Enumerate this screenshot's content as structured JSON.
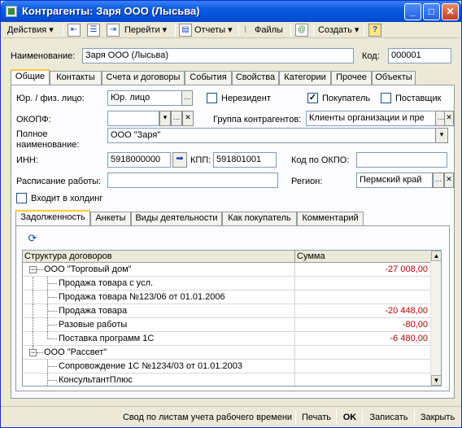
{
  "window": {
    "title": "Контрагенты: Заря ООО (Лысьва)"
  },
  "toolbar": {
    "actions": "Действия",
    "goto": "Перейти",
    "reports": "Отчеты",
    "files": "Файлы",
    "create": "Создать",
    "help": "?"
  },
  "header": {
    "name_label": "Наименование:",
    "name_value": "Заря ООО (Лысьва)",
    "code_label": "Код:",
    "code_value": "000001"
  },
  "tabs": [
    "Общие",
    "Контакты",
    "Счета и договоры",
    "События",
    "Свойства",
    "Категории",
    "Прочее",
    "Объекты"
  ],
  "general": {
    "entity_label": "Юр. / физ. лицо:",
    "entity_value": "Юр. лицо",
    "nonresident_label": "Нерезидент",
    "buyer_label": "Покупатель",
    "supplier_label": "Поставщик",
    "okopf_label": "ОКОПФ:",
    "group_label": "Группа контрагентов:",
    "group_value": "Клиенты организации и пре",
    "full_name_label_1": "Полное",
    "full_name_label_2": "наименование:",
    "full_name_value": "ООО \"Заря\"",
    "inn_label": "ИНН:",
    "inn_value": "5918000000",
    "kpp_label": "КПП:",
    "kpp_value": "591801001",
    "okpo_label": "Код по ОКПО:",
    "schedule_label": "Расписание работы:",
    "region_label": "Регион:",
    "region_value": "Пермский край",
    "holding_label": "Входит в холдинг"
  },
  "subtabs": [
    "Задолженность",
    "Анкеты",
    "Виды деятельности",
    "Как покупатель",
    "Комментарий"
  ],
  "grid": {
    "col_structure": "Структура договоров",
    "col_sum": "Сумма",
    "rows": [
      {
        "name": "ООО \"Торговый дом\"",
        "sum": "-27 008,00"
      },
      {
        "name": "Продажа товара с усл.",
        "sum": ""
      },
      {
        "name": "Продажа товара №123/06 от 01.01.2006",
        "sum": ""
      },
      {
        "name": "Продажа товара",
        "sum": "-20 448,00"
      },
      {
        "name": "Разовые работы",
        "sum": "-80,00"
      },
      {
        "name": "Поставка программ 1С",
        "sum": "-6 480,00"
      },
      {
        "name": "ООО \"Рассвет\"",
        "sum": ""
      },
      {
        "name": "Сопровождение 1С №1234/03 от 01.01.2003",
        "sum": ""
      },
      {
        "name": "КонсультантПлюс",
        "sum": ""
      }
    ]
  },
  "footer": {
    "timesheet": "Свод по листам учета рабочего времени",
    "print": "Печать",
    "ok": "OK",
    "save": "Записать",
    "close": "Закрыть"
  }
}
